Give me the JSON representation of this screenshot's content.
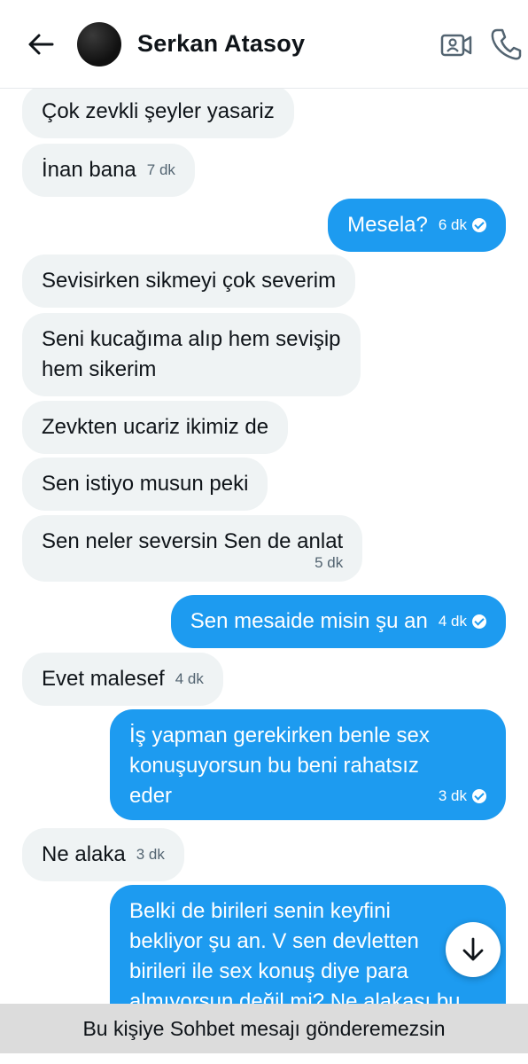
{
  "header": {
    "contact_name": "Serkan Atasoy",
    "back_icon": "arrow-left-icon",
    "video_icon": "video-call-icon",
    "call_icon": "phone-icon"
  },
  "messages": [
    {
      "side": "in",
      "text": "Çok zevkli şeyler yasariz",
      "time": ""
    },
    {
      "side": "in",
      "text": "İnan bana",
      "time": "7 dk"
    },
    {
      "side": "out",
      "text": "Mesela?",
      "time": "6 dk",
      "read": true
    },
    {
      "side": "in",
      "text": "Sevisirken sikmeyi çok severim",
      "time": ""
    },
    {
      "side": "in",
      "text_lines": [
        "Seni kucağıma alıp hem sevişip",
        "hem sikerim"
      ],
      "time": ""
    },
    {
      "side": "in",
      "text": "Zevkten ucariz ikimiz de",
      "time": ""
    },
    {
      "side": "in",
      "text": "Sen istiyo musun peki",
      "time": ""
    },
    {
      "side": "in",
      "text": "Sen neler seversin Sen de anlat",
      "time": "5 dk"
    },
    {
      "side": "out",
      "text": "Sen mesaide misin şu an",
      "time": "4 dk",
      "read": true
    },
    {
      "side": "in",
      "text": "Evet malesef",
      "time": "4 dk"
    },
    {
      "side": "out",
      "text_lines": [
        "İş yapman gerekirken benle sex",
        "konuşuyorsun bu beni rahatsız",
        "eder"
      ],
      "time": "3 dk",
      "read": true
    },
    {
      "side": "in",
      "text": "Ne alaka",
      "time": "3 dk"
    },
    {
      "side": "out",
      "text_lines": [
        "Belki de birileri senin keyfini",
        "bekliyor şu an. V sen devletten",
        "birileri ile sex konuş diye para",
        "almıyorsun değil mi? Ne alakası bu"
      ],
      "time": ""
    }
  ],
  "scroll_down_icon": "arrow-down-icon",
  "footer": {
    "notice": "Bu kişiye Sohbet mesajı gönderemezsin"
  },
  "colors": {
    "outgoing_bubble": "#1d9bf0",
    "incoming_bubble": "#eff3f4",
    "footer_bg": "#dcdcdc"
  }
}
